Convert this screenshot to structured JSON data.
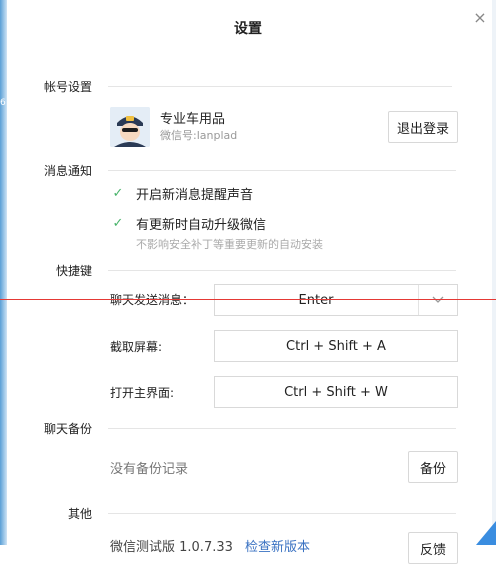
{
  "dialog": {
    "title": "设置",
    "close_symbol": "×"
  },
  "edge": {
    "marker": "6"
  },
  "account": {
    "section_label": "帐号设置",
    "name": "专业车用品",
    "wechat_id": "微信号:lanplad",
    "logout_label": "退出登录"
  },
  "notifications": {
    "section_label": "消息通知",
    "options": [
      {
        "label": "开启新消息提醒声音",
        "checked": true
      },
      {
        "label": "有更新时自动升级微信",
        "checked": true
      }
    ],
    "hint": "不影响安全补丁等重要更新的自动安装"
  },
  "shortcuts": {
    "section_label": "快捷键",
    "items": [
      {
        "label": "聊天发送消息：",
        "value": "Enter"
      },
      {
        "label": "截取屏幕:",
        "value": "Ctrl + Shift + A"
      },
      {
        "label": "打开主界面:",
        "value": "Ctrl + Shift + W"
      }
    ]
  },
  "backup": {
    "section_label": "聊天备份",
    "empty_text": "没有备份记录",
    "backup_label": "备份"
  },
  "other": {
    "section_label": "其他",
    "version_text": "微信测试版 1.0.7.33",
    "check_update_link": "检查新版本",
    "feedback_label": "反馈"
  },
  "colors": {
    "accent_green": "#49b36a",
    "link_blue": "#3a72c2",
    "red_line": "#e53935"
  }
}
